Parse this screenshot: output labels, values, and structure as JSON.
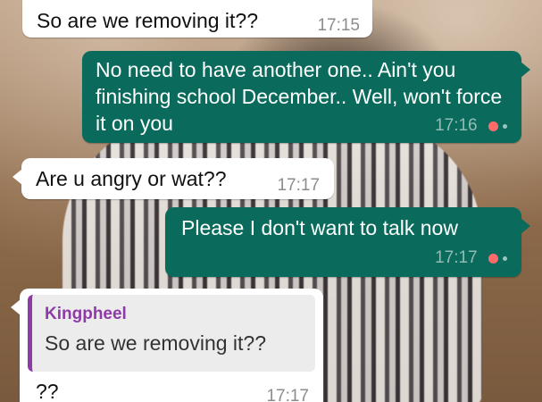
{
  "messages": [
    {
      "direction": "incoming",
      "text": "So are we removing it??",
      "time": "17:15"
    },
    {
      "direction": "outgoing",
      "text": "No need to have another one.. Ain't you finishing school December.. Well, won't force it on you",
      "time": "17:16"
    },
    {
      "direction": "incoming",
      "text": "Are u angry or wat??",
      "time": "17:17"
    },
    {
      "direction": "outgoing",
      "text": "Please I don't want to talk now",
      "time": "17:17"
    },
    {
      "direction": "incoming",
      "reply_to": {
        "author": "Kingpheel",
        "text": "So are we removing it??"
      },
      "text": "??",
      "time": "17:17"
    }
  ],
  "colors": {
    "outgoing_bubble": "#0a6b5c",
    "incoming_bubble": "#ffffff",
    "reply_accent": "#8e3aa7",
    "pending_dot": "#ff6b6b"
  }
}
